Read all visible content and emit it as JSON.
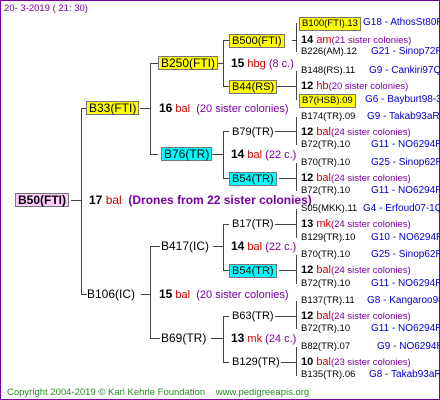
{
  "header": {
    "date": "20-  3-2019 (  21:  30)"
  },
  "footer": {
    "copyright": "Copyright 2004-2019 © Karl Kehrle Foundation",
    "url": "www.pedigreeapis.org"
  },
  "root": {
    "label": "B50(FTI)",
    "number": "17",
    "bal": "bal",
    "note": "(Drones from 22 sister colonies)"
  },
  "gen1": [
    {
      "label": "B33(FTI)",
      "number": "16",
      "bal": "bal",
      "note": "(20 sister colonies)"
    },
    {
      "label": "B106(IC)",
      "number": "15",
      "bal": "bal",
      "note": "(20 sister colonies)"
    }
  ],
  "gen2": [
    {
      "label": "B250(FTI)",
      "number": "15",
      "bal": "hbg",
      "note": "(8 c.)"
    },
    {
      "label": "B76(TR)",
      "number": "14",
      "bal": "bal",
      "note": "(22 c.)"
    },
    {
      "label": "B417(IC)",
      "number": "14",
      "bal": "bal",
      "note": "(22 c.)"
    },
    {
      "label": "B69(TR)",
      "number": "13",
      "bal": "mk",
      "note": "(24 c.)"
    }
  ],
  "gen3": [
    {
      "label": "B500(FTI)",
      "number": "14",
      "bal": "am",
      "note": "(21 sister colonies)"
    },
    {
      "label": "B44(RS)",
      "number": "12",
      "bal": "hb",
      "note": "(20 sister colonies)"
    },
    {
      "label": "B79(TR)",
      "number": "12",
      "bal": "bal",
      "note": "(24 sister colonies)"
    },
    {
      "label": "B54(TR)",
      "number": "12",
      "bal": "bal",
      "note": "(24 sister colonies)"
    },
    {
      "label": "B17(TR)",
      "number": "13",
      "bal": "mk",
      "note": "(24 sister colonies)"
    },
    {
      "label": "B54(TR)",
      "number": "12",
      "bal": "bal",
      "note": "(24 sister colonies)"
    },
    {
      "label": "B63(TR)",
      "number": "12",
      "bal": "bal",
      "note": "(24 sister colonies)"
    },
    {
      "label": "B129(TR)",
      "number": "10",
      "bal": "bal",
      "note": "(23 sister colonies)"
    }
  ],
  "gen4": [
    {
      "label": "B100(FTI).13",
      "link": "G18 - AthosSt80R"
    },
    {
      "label": "B226(AM).12",
      "link": "G21 - Sinop72R"
    },
    {
      "label": "B148(RS).11",
      "link": "G9 - Cankiri97Q"
    },
    {
      "label": "B7(HSB).09",
      "link": "G6 - Bayburt98-3"
    },
    {
      "label": "B174(TR).09",
      "link": "G9 - Takab93aR"
    },
    {
      "label": "B72(TR).10",
      "link": "G11 - NO6294R"
    },
    {
      "label": "B70(TR).10",
      "link": "G25 - Sinop62R"
    },
    {
      "label": "B72(TR).10",
      "link": "G11 - NO6294R"
    },
    {
      "label": "S05(MKK).11",
      "link": "G4 - Erfoud07-1Q"
    },
    {
      "label": "B129(TR).10",
      "link": "G10 - NO6294R"
    },
    {
      "label": "B70(TR).10",
      "link": "G25 - Sinop62R"
    },
    {
      "label": "B72(TR).10",
      "link": "G11 - NO6294R"
    },
    {
      "label": "B137(TR).11",
      "link": "G8 - Kangaroo98R"
    },
    {
      "label": "B72(TR).10",
      "link": "G11 - NO6294R"
    },
    {
      "label": "B82(TR).07",
      "link": "G9 - NO6294R"
    },
    {
      "label": "B135(TR).06",
      "link": "G8 - Takab93aR"
    }
  ]
}
